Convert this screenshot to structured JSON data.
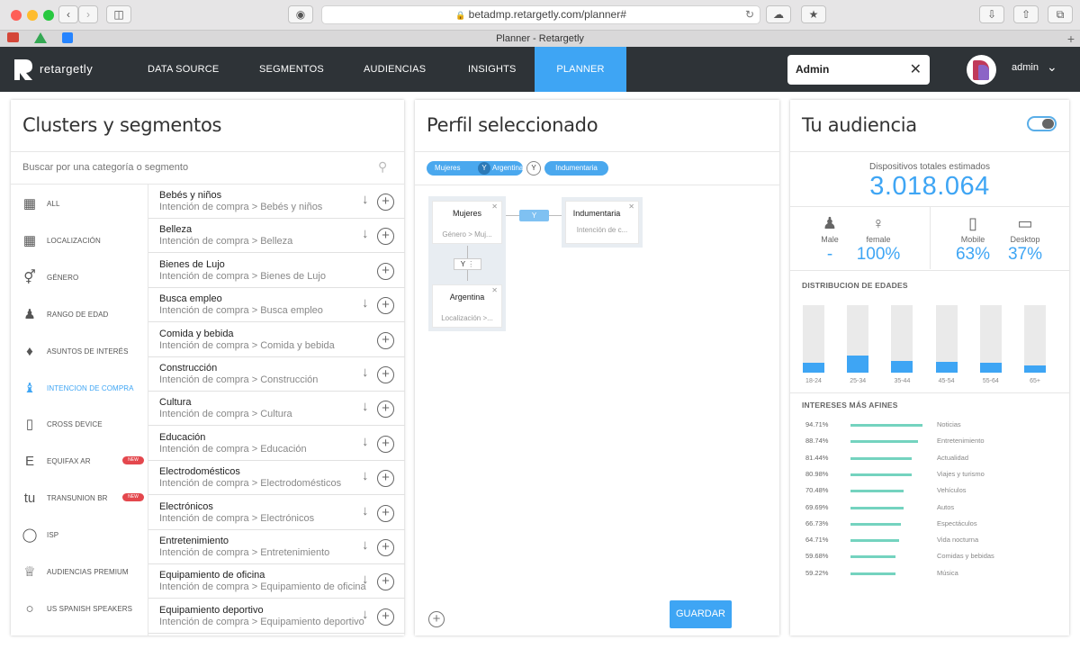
{
  "browser": {
    "url": "betadmp.retargetly.com/planner#",
    "tab_title": "Planner - Retargetly"
  },
  "nav": {
    "brand": "retargetly",
    "items": [
      "DATA SOURCE",
      "SEGMENTOS",
      "AUDIENCIAS",
      "INSIGHTS",
      "PLANNER"
    ],
    "active": "PLANNER",
    "search_value": "Admin",
    "user": "admin"
  },
  "clusters": {
    "title": "Clusters y segmentos",
    "search_placeholder": "Buscar por una categoría o segmento",
    "categories": [
      {
        "label": "ALL",
        "icon": "grid-icon"
      },
      {
        "label": "LOCALIZACIÓN",
        "icon": "map-icon"
      },
      {
        "label": "GÉNERO",
        "icon": "gender-icon"
      },
      {
        "label": "RANGO DE EDAD",
        "icon": "age-icon"
      },
      {
        "label": "ASUNTOS DE INTERÉS",
        "icon": "interest-icon"
      },
      {
        "label": "INTENCION DE COMPRA",
        "icon": "shirt-icon"
      },
      {
        "label": "CROSS DEVICE",
        "icon": "device-icon"
      },
      {
        "label": "EQUIFAX AR",
        "icon": "equifax-icon",
        "badge": "NEW"
      },
      {
        "label": "TRANSUNION BR",
        "icon": "transunion-icon",
        "badge": "NEW"
      },
      {
        "label": "ISP",
        "icon": "globe-icon"
      },
      {
        "label": "AUDIENCIAS PREMIUM",
        "icon": "crown-icon"
      },
      {
        "label": "US SPANISH SPEAKERS",
        "icon": "chat-icon"
      }
    ],
    "active_category": "INTENCION DE COMPRA",
    "segments": [
      {
        "name": "Bebés y niños",
        "path": "Intención de compra > Bebés y niños",
        "expand": true
      },
      {
        "name": "Belleza",
        "path": "Intención de compra > Belleza",
        "expand": true
      },
      {
        "name": "Bienes de Lujo",
        "path": "Intención de compra > Bienes de Lujo",
        "expand": false
      },
      {
        "name": "Busca empleo",
        "path": "Intención de compra > Busca empleo",
        "expand": true
      },
      {
        "name": "Comida y bebida",
        "path": "Intención de compra > Comida y bebida",
        "expand": false
      },
      {
        "name": "Construcción",
        "path": "Intención de compra > Construcción",
        "expand": true
      },
      {
        "name": "Cultura",
        "path": "Intención de compra > Cultura",
        "expand": true
      },
      {
        "name": "Educación",
        "path": "Intención de compra > Educación",
        "expand": true
      },
      {
        "name": "Electrodomésticos",
        "path": "Intención de compra > Electrodomésticos",
        "expand": true
      },
      {
        "name": "Electrónicos",
        "path": "Intención de compra > Electrónicos",
        "expand": true
      },
      {
        "name": "Entretenimiento",
        "path": "Intención de compra > Entretenimiento",
        "expand": true
      },
      {
        "name": "Equipamiento de oficina",
        "path": "Intención de compra > Equipamiento de oficina",
        "expand": true
      },
      {
        "name": "Equipamiento deportivo",
        "path": "Intención de compra > Equipamiento deportivo",
        "expand": true
      }
    ]
  },
  "perfil": {
    "title": "Perfil seleccionado",
    "chips": {
      "first": "Mujeres",
      "and1": "Y",
      "second": "Argentina",
      "and2": "Y",
      "third": "Indumentaria"
    },
    "nodes": {
      "mujeres": {
        "title": "Mujeres",
        "sub": "Género > Muj..."
      },
      "indumentaria": {
        "title": "Indumentaria",
        "sub": "Intención de c..."
      },
      "argentina": {
        "title": "Argentina",
        "sub": "Localización >..."
      },
      "and_h": "Y",
      "and_v": "Y"
    },
    "save_label": "GUARDAR"
  },
  "audiencia": {
    "title": "Tu audiencia",
    "devices_label": "Dispositivos totales estimados",
    "devices_total": "3.018.064",
    "genders": [
      {
        "label": "Male",
        "value": "-"
      },
      {
        "label": "female",
        "value": "100%"
      }
    ],
    "devices": [
      {
        "label": "Mobile",
        "value": "63%"
      },
      {
        "label": "Desktop",
        "value": "37%"
      }
    ],
    "ages_title": "DISTRIBUCION DE EDADES",
    "ages": [
      {
        "label": "18-24",
        "fraction": 0.15
      },
      {
        "label": "25-34",
        "fraction": 0.25
      },
      {
        "label": "35-44",
        "fraction": 0.17
      },
      {
        "label": "45-54",
        "fraction": 0.16
      },
      {
        "label": "55-64",
        "fraction": 0.15
      },
      {
        "label": "65+",
        "fraction": 0.11
      }
    ],
    "interests_title": "INTERESES MÁS AFINES",
    "interests": [
      {
        "pct": "94.71%",
        "value": 94.71,
        "name": "Noticias"
      },
      {
        "pct": "88.74%",
        "value": 88.74,
        "name": "Entretenimiento"
      },
      {
        "pct": "81.44%",
        "value": 81.44,
        "name": "Actualidad"
      },
      {
        "pct": "80.98%",
        "value": 80.98,
        "name": "Viajes y turismo"
      },
      {
        "pct": "70.48%",
        "value": 70.48,
        "name": "Vehículos"
      },
      {
        "pct": "69.69%",
        "value": 69.69,
        "name": "Autos"
      },
      {
        "pct": "66.73%",
        "value": 66.73,
        "name": "Espectáculos"
      },
      {
        "pct": "64.71%",
        "value": 64.71,
        "name": "Vida nocturna"
      },
      {
        "pct": "59.68%",
        "value": 59.68,
        "name": "Comidas y bebidas"
      },
      {
        "pct": "59.22%",
        "value": 59.22,
        "name": "Música"
      }
    ]
  },
  "colors": {
    "accent": "#3ea5f4",
    "nav_bg": "#2e3337",
    "interest_bar": "#74d3bf",
    "badge": "#e4474d"
  }
}
